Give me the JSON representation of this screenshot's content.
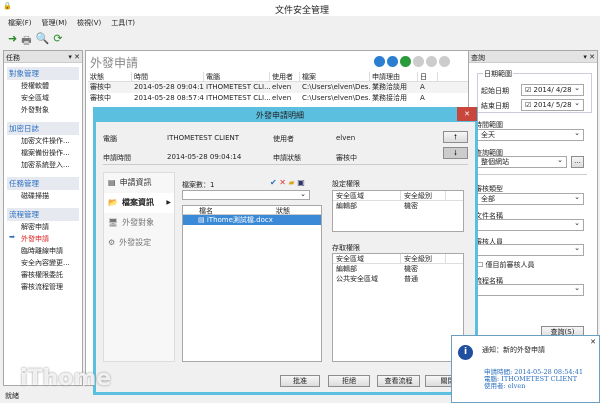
{
  "window": {
    "title": "文件安全管理",
    "status": "就緒"
  },
  "menu": [
    "檔案(F)",
    "管理(M)",
    "檢視(V)",
    "工具(T)"
  ],
  "left_panel": {
    "title": "任務",
    "groups": [
      {
        "title": "對象管理",
        "items": [
          "授權軟體",
          "安全區域",
          "外發對象"
        ]
      },
      {
        "title": "加密日誌",
        "items": [
          "加密文件操作...",
          "檔案備份操作...",
          "加密系統登入..."
        ]
      },
      {
        "title": "任務管理",
        "items": [
          "磁碟掃描"
        ]
      },
      {
        "title": "流程管理",
        "items": [
          "解密申請",
          "外發申請",
          "臨時離線申請",
          "安全內容變更...",
          "審核權限委託",
          "審核流程管理"
        ],
        "active": "外發申請"
      }
    ]
  },
  "main": {
    "title": "外發申請",
    "columns": [
      "狀態",
      "時間",
      "電腦",
      "使用者",
      "檔案",
      "申請理由",
      "日"
    ],
    "rows": [
      [
        "審核中",
        "2014-05-28 09:04:14",
        "ITHOMETEST CLI...",
        "elven",
        "C:\\Users\\elven\\Des...",
        "業務洽談用",
        "A"
      ],
      [
        "審核中",
        "2014-05-28 08:57:49",
        "ITHOMETEST CLI...",
        "elven",
        "C:\\Users\\elven\\Des...",
        "業務接洽用",
        "A"
      ]
    ]
  },
  "dialog": {
    "title": "外發申請明細",
    "computer_label": "電腦",
    "computer": "ITHOMETEST CLIENT",
    "user_label": "使用者",
    "user": "elven",
    "time_label": "申請時間",
    "time": "2014-05-28 09:04:14",
    "status_label": "申請狀態",
    "status": "審核中",
    "nav": [
      "申請資訊",
      "檔案資訊",
      "外發對象",
      "外發設定"
    ],
    "nav_active": "檔案資訊",
    "file_count": "檔案數：1",
    "file_columns": [
      "檔名",
      "狀態"
    ],
    "files": [
      "iThome測試檔.docx"
    ],
    "set_perm": {
      "title": "設定權限",
      "columns": [
        "安全區域",
        "安全級別"
      ],
      "rows": [
        [
          "編輯部",
          "機密"
        ]
      ]
    },
    "access_perm": {
      "title": "存取權限",
      "columns": [
        "安全區域",
        "安全級別"
      ],
      "rows": [
        [
          "編輯部",
          "機密"
        ],
        [
          "公共安全區域",
          "普通"
        ]
      ]
    },
    "buttons": [
      "批准",
      "拒絕",
      "查看流程",
      "關閉"
    ]
  },
  "query": {
    "title": "查詢",
    "date_group": "日期範圍",
    "start_label": "起始日期",
    "start": "2014/ 4/28",
    "end_label": "結束日期",
    "end": "2014/ 5/28",
    "time_label": "時間範圍",
    "time": "全天",
    "scope_label": "查詢範圍",
    "scope": "整個網站",
    "type_label": "審核類型",
    "type": "全部",
    "file_label": "文件名稱",
    "reviewer_label": "審核人員",
    "only_current": "僅目前審核人員",
    "flow_label": "流程名稱",
    "button": "查詢(S)"
  },
  "notify": {
    "title": "通知：新的外發申請",
    "time": "申請時間: 2014-05-28 08:54:41",
    "computer": "電腦: ITHOMETEST CLIENT",
    "user": "使用者: elven"
  },
  "watermark": "iThome"
}
